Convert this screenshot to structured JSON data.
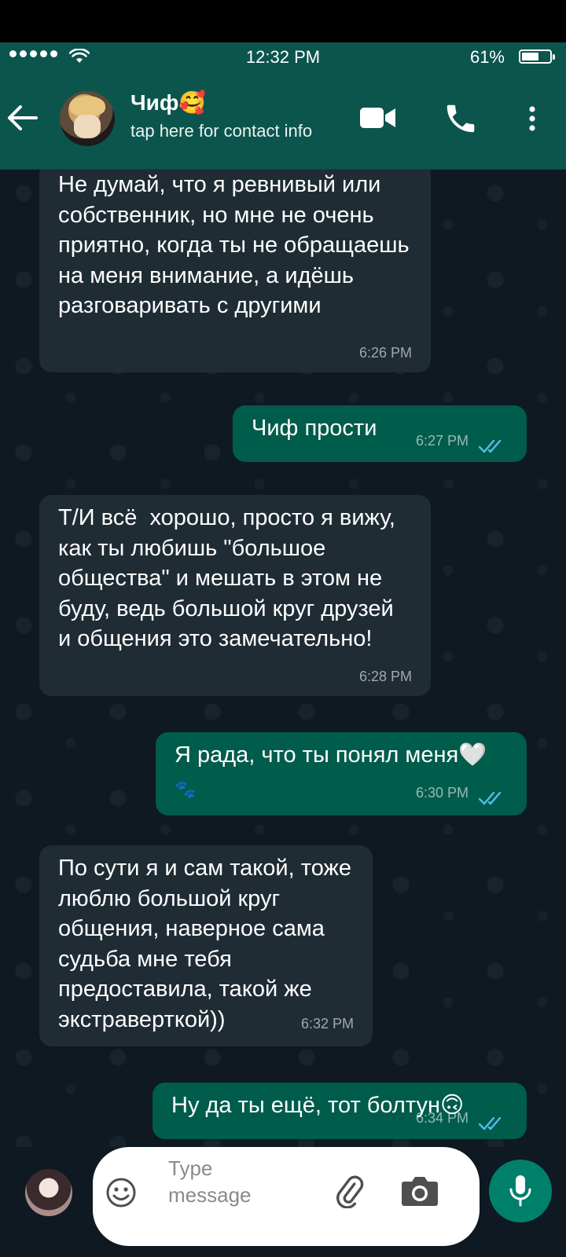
{
  "status_bar": {
    "time": "12:32 PM",
    "battery_percent": "61%",
    "battery_level": 0.61
  },
  "header": {
    "contact_name": "Чиф🥰",
    "subtitle": "tap here for contact info"
  },
  "messages": [
    {
      "direction": "in",
      "text": "Не думай, что я ревнивый или собственник, но мне не очень приятно, когда ты не обращаешь на меня внимание, а идёшь разговаривать с другими",
      "time": "6:26 PM"
    },
    {
      "direction": "out",
      "text": "Чиф прости",
      "time": "6:27 PM",
      "status": "read"
    },
    {
      "direction": "in",
      "text": "Т/И всё  хорошо, просто я вижу, как ты любишь \"большое общества\" и мешать в этом не буду, ведь большой круг друзей и общения это замечательно!",
      "time": "6:28 PM"
    },
    {
      "direction": "out",
      "text": "Я рада, что ты понял меня🤍",
      "emoji_line": "🐾",
      "time": "6:30 PM",
      "status": "read"
    },
    {
      "direction": "in",
      "text": "По сути я и сам такой, тоже люблю большой круг общения, наверное сама судьба мне тебя предоставила, такой же экстраверткой))",
      "time": "6:32 PM"
    },
    {
      "direction": "out",
      "text": "Ну да ты ещё, тот болтун🙃",
      "time": "6:34 PM",
      "status": "read"
    }
  ],
  "input_bar": {
    "placeholder": "Type message"
  },
  "colors": {
    "header": "#0b554d",
    "incoming_bubble": "#1f2c34",
    "outgoing_bubble": "#005c4b",
    "read_ticks": "#53bdeb",
    "mic_button": "#00806b"
  },
  "icons": {
    "back": "back-arrow-icon",
    "video": "video-call-icon",
    "call": "phone-icon",
    "menu": "more-vert-icon",
    "emoji": "emoji-icon",
    "attach": "paperclip-icon",
    "camera": "camera-icon",
    "mic": "mic-icon"
  }
}
